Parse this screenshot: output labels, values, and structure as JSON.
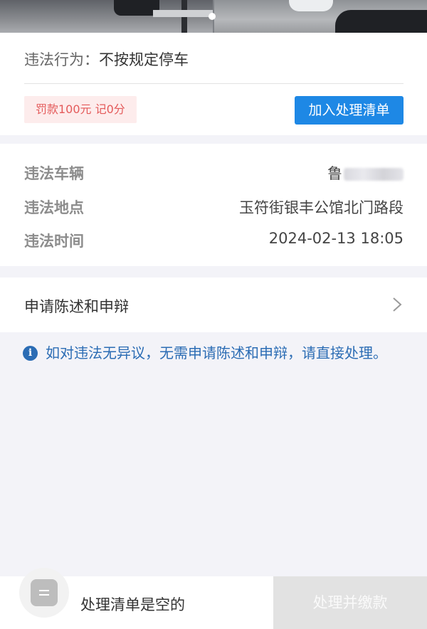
{
  "carousel": {
    "photo_left_label": "",
    "photo_right_label": ""
  },
  "violation": {
    "behavior_label": "违法行为：",
    "behavior_value": "不按规定停车",
    "fine_badge": "罚款100元 记0分",
    "add_button": "加入处理清单"
  },
  "details": {
    "vehicle_label": "违法车辆",
    "vehicle_value": "鲁",
    "location_label": "违法地点",
    "location_value": "玉符街银丰公馆北门路段",
    "time_label": "违法时间",
    "time_value": "2024-02-13 18:05"
  },
  "appeal": {
    "label": "申请陈述和申辩"
  },
  "notice": {
    "icon": "info-icon",
    "text": "如对违法无异议，无需申请陈述和申辩，请直接处理。"
  },
  "bottom": {
    "cart_icon": "list-icon",
    "empty_text": "处理清单是空的",
    "pay_button": "处理并缴款"
  },
  "colors": {
    "accent": "#1e88e5",
    "notice": "#2b6cb4",
    "fine_text": "#e45a5a",
    "fine_bg": "#fdecec",
    "page_bg": "#f3f3f8"
  }
}
